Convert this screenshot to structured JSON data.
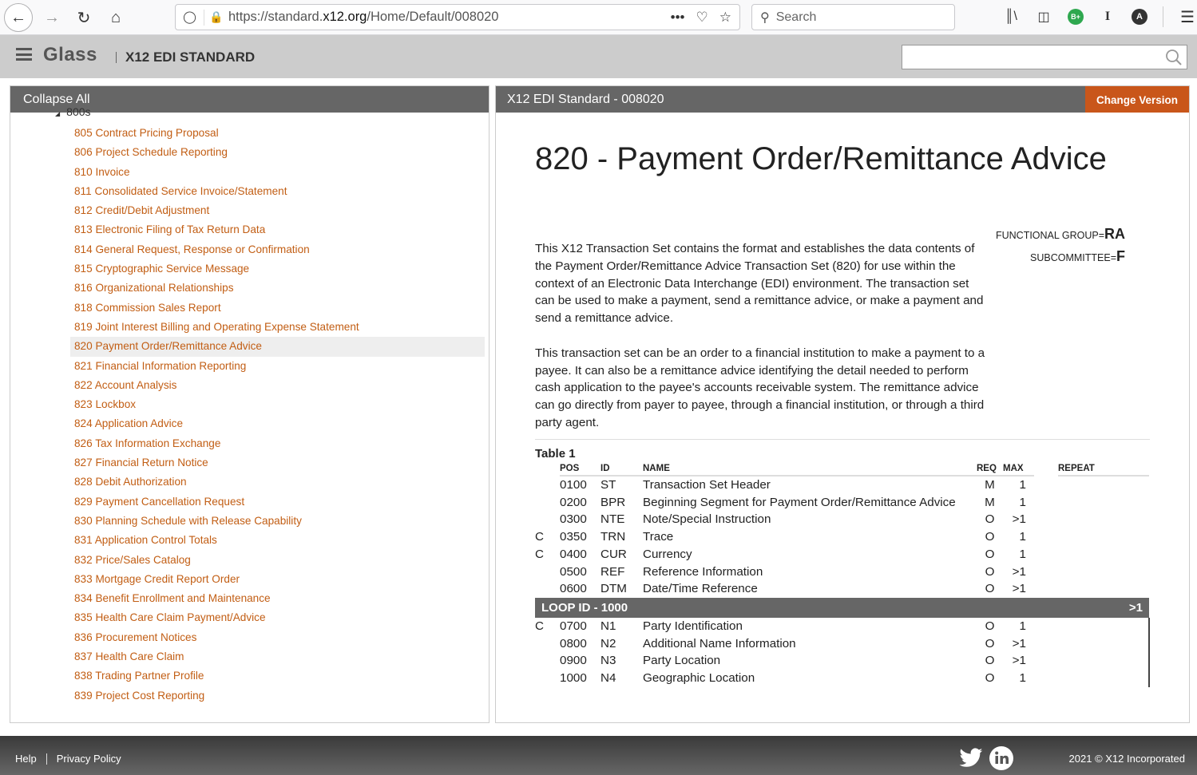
{
  "browser": {
    "url_prefix": "https://standard.",
    "url_domain": "x12.org",
    "url_path": "/Home/Default/008020",
    "search_placeholder": "Search",
    "ext_badge": "B+",
    "ext_cursor": "I",
    "account_initial": "A"
  },
  "header": {
    "brand": "Glass",
    "subtitle": "X12 EDI STANDARD",
    "search_value": ""
  },
  "left_panel": {
    "header": "Collapse All",
    "group_label": "800s",
    "items": [
      {
        "label": "805 Contract Pricing Proposal",
        "active": false
      },
      {
        "label": "806 Project Schedule Reporting",
        "active": false
      },
      {
        "label": "810 Invoice",
        "active": false
      },
      {
        "label": "811 Consolidated Service Invoice/Statement",
        "active": false
      },
      {
        "label": "812 Credit/Debit Adjustment",
        "active": false
      },
      {
        "label": "813 Electronic Filing of Tax Return Data",
        "active": false
      },
      {
        "label": "814 General Request, Response or Confirmation",
        "active": false
      },
      {
        "label": "815 Cryptographic Service Message",
        "active": false
      },
      {
        "label": "816 Organizational Relationships",
        "active": false
      },
      {
        "label": "818 Commission Sales Report",
        "active": false
      },
      {
        "label": "819 Joint Interest Billing and Operating Expense Statement",
        "active": false
      },
      {
        "label": "820 Payment Order/Remittance Advice",
        "active": true
      },
      {
        "label": "821 Financial Information Reporting",
        "active": false
      },
      {
        "label": "822 Account Analysis",
        "active": false
      },
      {
        "label": "823 Lockbox",
        "active": false
      },
      {
        "label": "824 Application Advice",
        "active": false
      },
      {
        "label": "826 Tax Information Exchange",
        "active": false
      },
      {
        "label": "827 Financial Return Notice",
        "active": false
      },
      {
        "label": "828 Debit Authorization",
        "active": false
      },
      {
        "label": "829 Payment Cancellation Request",
        "active": false
      },
      {
        "label": "830 Planning Schedule with Release Capability",
        "active": false
      },
      {
        "label": "831 Application Control Totals",
        "active": false
      },
      {
        "label": "832 Price/Sales Catalog",
        "active": false
      },
      {
        "label": "833 Mortgage Credit Report Order",
        "active": false
      },
      {
        "label": "834 Benefit Enrollment and Maintenance",
        "active": false
      },
      {
        "label": "835 Health Care Claim Payment/Advice",
        "active": false
      },
      {
        "label": "836 Procurement Notices",
        "active": false
      },
      {
        "label": "837 Health Care Claim",
        "active": false
      },
      {
        "label": "838 Trading Partner Profile",
        "active": false
      },
      {
        "label": "839 Project Cost Reporting",
        "active": false
      }
    ]
  },
  "right_panel": {
    "header": "X12 EDI Standard - 008020",
    "change_version": "Change Version",
    "title": "820 - Payment Order/Remittance Advice",
    "functional_group_label": "FUNCTIONAL GROUP=",
    "functional_group_value": "RA",
    "subcommittee_label": "SUBCOMMITTEE=",
    "subcommittee_value": "F",
    "description": [
      "This X12 Transaction Set contains the format and establishes the data contents of the Payment Order/Remittance Advice Transaction Set (820) for use within the context of an Electronic Data Interchange (EDI) environment. The transaction set can be used to make a payment, send a remittance advice, or make a payment and send a remittance advice.",
      "This transaction set can be an order to a financial institution to make a payment to a payee. It can also be a remittance advice identifying the detail needed to perform cash application to the payee's accounts receivable system. The remittance advice can go directly from payer to payee, through a financial institution, or through a third party agent."
    ],
    "table": {
      "title": "Table 1",
      "columns": {
        "pos": "POS",
        "id": "ID",
        "name": "NAME",
        "req": "REQ",
        "max": "MAX",
        "repeat": "REPEAT"
      },
      "rows": [
        {
          "c": "",
          "pos": "0100",
          "id": "ST",
          "name": "Transaction Set Header",
          "req": "M",
          "max": "1"
        },
        {
          "c": "",
          "pos": "0200",
          "id": "BPR",
          "name": "Beginning Segment for Payment Order/Remittance Advice",
          "req": "M",
          "max": "1"
        },
        {
          "c": "",
          "pos": "0300",
          "id": "NTE",
          "name": "Note/Special Instruction",
          "req": "O",
          "max": ">1"
        },
        {
          "c": "C",
          "pos": "0350",
          "id": "TRN",
          "name": "Trace",
          "req": "O",
          "max": "1"
        },
        {
          "c": "C",
          "pos": "0400",
          "id": "CUR",
          "name": "Currency",
          "req": "O",
          "max": "1"
        },
        {
          "c": "",
          "pos": "0500",
          "id": "REF",
          "name": "Reference Information",
          "req": "O",
          "max": ">1"
        },
        {
          "c": "",
          "pos": "0600",
          "id": "DTM",
          "name": "Date/Time Reference",
          "req": "O",
          "max": ">1"
        }
      ],
      "loop": {
        "label": "LOOP ID - 1000",
        "repeat": ">1",
        "rows": [
          {
            "c": "C",
            "pos": "0700",
            "id": "N1",
            "name": "Party Identification",
            "req": "O",
            "max": "1"
          },
          {
            "c": "",
            "pos": "0800",
            "id": "N2",
            "name": "Additional Name Information",
            "req": "O",
            "max": ">1"
          },
          {
            "c": "",
            "pos": "0900",
            "id": "N3",
            "name": "Party Location",
            "req": "O",
            "max": ">1"
          },
          {
            "c": "",
            "pos": "1000",
            "id": "N4",
            "name": "Geographic Location",
            "req": "O",
            "max": "1"
          }
        ]
      }
    }
  },
  "footer": {
    "help": "Help",
    "privacy": "Privacy Policy",
    "copyright": "2021 © X12 Incorporated"
  },
  "colors": {
    "accent": "#c9561a",
    "link": "#c25e14",
    "panel_header": "#666666",
    "app_header": "#cccccc"
  }
}
